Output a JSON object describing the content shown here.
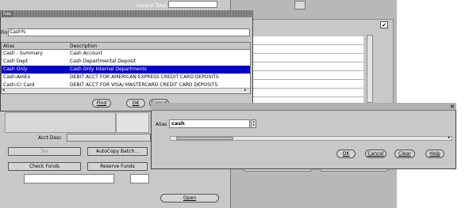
{
  "background_form": {
    "control_total_label": "Control Total",
    "acct_desc_label": "Acct Desc",
    "buttons": {
      "tax": "Tax",
      "autocopy_batch": "AutoCopy Batch...",
      "check_funds": "Check Funds",
      "reserve_funds": "Reserve Funds",
      "open": "Open"
    },
    "checkbox_mark": "✔"
  },
  "lov_window": {
    "title": "lias",
    "find_label": "Find",
    "find_value": "Cash%",
    "columns": [
      "Alias",
      "Description"
    ],
    "rows": [
      {
        "alias": "Cash - Summary",
        "description": "Cash Account",
        "selected": false
      },
      {
        "alias": "Cash Dept",
        "description": "Cash Departmental Deposit",
        "selected": false
      },
      {
        "alias": "Cash Only",
        "description": "Cash Only Internal Departments",
        "selected": true
      },
      {
        "alias": "Cash-AmEx",
        "description": "DEBIT ACCT FOR AMERICAN EXPRESS CREDIT CARD DEPOSITS",
        "selected": false
      },
      {
        "alias": "Cash-Cr Card",
        "description": "DEBIT ACCT FOR VISA/ MASTERCARD CREDIT CARD DEPOSITS",
        "selected": false
      }
    ],
    "buttons": {
      "find": "Find",
      "ok": "OK",
      "cancel": "Cancel"
    }
  },
  "alias_window": {
    "close_glyph": "×",
    "alias_label": "Alias",
    "alias_value": "cash",
    "buttons": {
      "ok": "OK",
      "cancel": "Cancel",
      "clear": "Clear",
      "help": "Help"
    }
  },
  "colors": {
    "selection": "#0000cc",
    "window_gray": "#c8c8c8",
    "title_stripe": "#666666"
  }
}
